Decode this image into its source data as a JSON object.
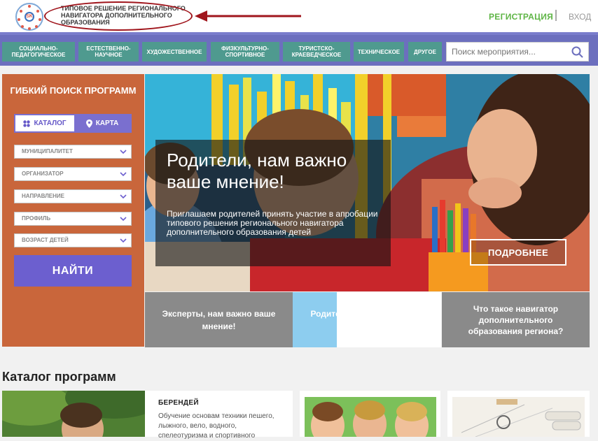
{
  "header": {
    "site_title": "ТИПОВОЕ РЕШЕНИЕ РЕГИОНАЛЬНОГО НАВИГАТОРА ДОПОЛНИТЕЛЬНОГО ОБРАЗОВАНИЯ",
    "logo_text": "SK",
    "register": "РЕГИСТРАЦИЯ",
    "login": "ВХОД"
  },
  "nav": {
    "items": [
      {
        "label": "СОЦИАЛЬНО-ПЕДАГОГИЧЕСКОЕ"
      },
      {
        "label": "ЕСТЕСТВЕННО-НАУЧНОЕ"
      },
      {
        "label": "ХУДОЖЕСТВЕННОЕ"
      },
      {
        "label": "ФИЗКУЛЬТУРНО-СПОРТИВНОЕ"
      },
      {
        "label": "ТУРИСТСКО-КРАЕВЕДЧЕСКОЕ"
      },
      {
        "label": "ТЕХНИЧЕСКОЕ"
      },
      {
        "label": "ДРУГОЕ"
      }
    ],
    "search_placeholder": "Поиск мероприятия..."
  },
  "sidebar": {
    "title": "ГИБКИЙ ПОИСК ПРОГРАММ",
    "tab_catalog": "КАТАЛОГ",
    "tab_map": "КАРТА",
    "filters": [
      {
        "label": "МУНИЦИПАЛИТЕТ"
      },
      {
        "label": "ОРГАНИЗАТОР"
      },
      {
        "label": "НАПРАВЛЕНИЕ"
      },
      {
        "label": "ПРОФИЛЬ"
      },
      {
        "label": "ВОЗРАСТ ДЕТЕЙ"
      }
    ],
    "find": "НАЙТИ"
  },
  "hero": {
    "title": "Родители, нам важно ваше мнение!",
    "text": "Приглашаем родителей принять участие в апробации типового решения регионального навигатора дополнительного образования детей",
    "more": "ПОДРОБНЕЕ"
  },
  "tiles": [
    {
      "label": "Эксперты, нам важно ваше мнение!"
    },
    {
      "label": "Родители, нам важно ваше мнение!"
    },
    {
      "label": "Что такое навигатор дополнительного образования региона?"
    }
  ],
  "catalog": {
    "title": "Каталог программ",
    "first_card": {
      "name": "БЕРЕНДЕЙ",
      "description": "Обучение основам техники пешего, лыжного, вело, водного, спелеотуризма и спортивного"
    }
  },
  "colors": {
    "nav_bg": "#6c6fbe",
    "nav_button": "#4f9a8f",
    "sidebar": "#c9663b",
    "accent": "#6c5fcf",
    "register": "#5fb546",
    "annotation": "#a0151c"
  }
}
